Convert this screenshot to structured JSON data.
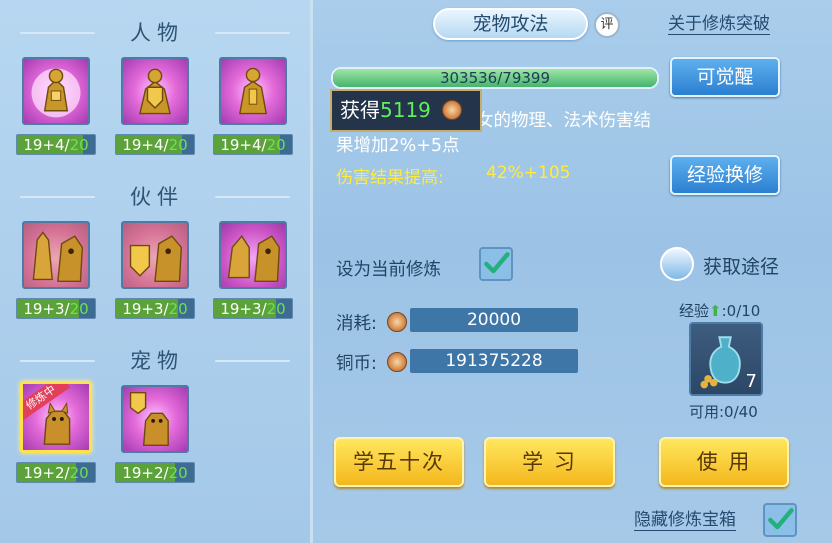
{
  "left": {
    "sections": [
      {
        "title": "人物",
        "slots": [
          {
            "level": "19+4/",
            "max": "20",
            "progress": 0.85
          },
          {
            "level": "19+4/",
            "max": "20",
            "progress": 0.85
          },
          {
            "level": "19+4/",
            "max": "20",
            "progress": 0.85
          }
        ]
      },
      {
        "title": "伙伴",
        "slots": [
          {
            "level": "19+3/",
            "max": "20",
            "progress": 0.8
          },
          {
            "level": "19+3/",
            "max": "20",
            "progress": 0.8
          },
          {
            "level": "19+3/",
            "max": "20",
            "progress": 0.8
          }
        ]
      },
      {
        "title": "宠物",
        "slots": [
          {
            "level": "19+2/",
            "max": "20",
            "progress": 0.75,
            "badge": "修炼中"
          },
          {
            "level": "19+2/",
            "max": "20",
            "progress": 0.75
          }
        ]
      }
    ]
  },
  "main": {
    "tab_title": "宠物攻法",
    "rate_label": "评",
    "breakthrough_link": "关于修炼突破",
    "exp_bar": {
      "text": "303536/79399",
      "fill": 1.0
    },
    "awaken_button": "可觉醒",
    "description": "等级可提宠物和子女的物理、法术伤害结果增加2%+5点",
    "boost_label": "伤害结果提高:",
    "boost_value": "42%+105",
    "exchange_button": "经验换修",
    "tooltip": {
      "prefix": "获得",
      "amount": "5119"
    },
    "set_current_label": "设为当前修炼",
    "set_current_checked": true,
    "acquire_link": "获取途径",
    "cost_label": "消耗:",
    "cost_value": "20000",
    "copper_label": "铜币:",
    "copper_value": "191375228",
    "item": {
      "exp_label": "经验",
      "exp_value": ":0/10",
      "count": "7",
      "usable": "可用:0/40"
    },
    "learn50_button": "学五十次",
    "learn_button": "学 习",
    "use_button": "使 用",
    "hide_label": "隐藏修炼宝箱",
    "hide_checked": true
  },
  "colors": {
    "accent_green": "#5ef05a",
    "boost_yellow": "#ffec3a",
    "button_blue": "#2b7fd0",
    "button_yellow": "#f4b71d"
  }
}
